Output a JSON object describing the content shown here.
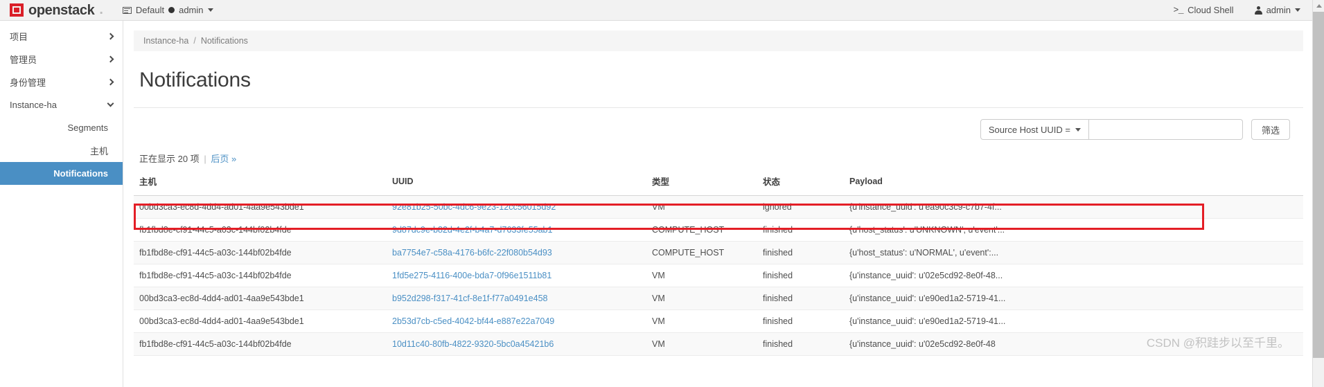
{
  "navbar": {
    "brand": "openstack",
    "brand_dot": ".",
    "domain_label": "Default",
    "project_label": "admin",
    "cloud_shell_icon": ">_",
    "cloud_shell_label": "Cloud Shell",
    "user_label": "admin"
  },
  "sidebar": {
    "groups": [
      {
        "label": "项目",
        "state": "collapsed"
      },
      {
        "label": "管理员",
        "state": "collapsed"
      },
      {
        "label": "身份管理",
        "state": "collapsed"
      },
      {
        "label": "Instance-ha",
        "state": "expanded"
      }
    ],
    "subitems": [
      {
        "label": "Segments",
        "active": false
      },
      {
        "label": "主机",
        "active": false
      },
      {
        "label": "Notifications",
        "active": true
      }
    ]
  },
  "breadcrumb": {
    "parent": "Instance-ha",
    "separator": "/",
    "current": "Notifications"
  },
  "page": {
    "title": "Notifications"
  },
  "toolbar": {
    "filter_field_label": "Source Host UUID =",
    "filter_input_value": "",
    "filter_input_placeholder": "",
    "filter_button_label": "筛选"
  },
  "summary": {
    "count_text": "正在显示 20 项",
    "separator": "|",
    "next_page_label": "后页 »"
  },
  "table": {
    "columns": [
      "主机",
      "UUID",
      "类型",
      "状态",
      "Payload"
    ],
    "rows": [
      {
        "host": "00bd3ca3-ec8d-4dd4-ad01-4aa9e543bde1",
        "uuid": "92e81b25-50bc-4dc6-9e23-12cc56015d92",
        "type": "VM",
        "status": "ignored",
        "payload": "{u'instance_uuid': u'ea90c3c9-c7b7-4f...",
        "highlighted": false
      },
      {
        "host": "fb1fbd8e-cf91-44c5-a03c-144bf02b4fde",
        "uuid": "9d87dc9e-b82d-4e2f-b4a7-d7633fe55ab1",
        "type": "COMPUTE_HOST",
        "status": "finished",
        "payload": "{u'host_status': u'UNKNOWN', u'event'...",
        "highlighted": true
      },
      {
        "host": "fb1fbd8e-cf91-44c5-a03c-144bf02b4fde",
        "uuid": "ba7754e7-c58a-4176-b6fc-22f080b54d93",
        "type": "COMPUTE_HOST",
        "status": "finished",
        "payload": "{u'host_status': u'NORMAL', u'event':...",
        "highlighted": false
      },
      {
        "host": "fb1fbd8e-cf91-44c5-a03c-144bf02b4fde",
        "uuid": "1fd5e275-4116-400e-bda7-0f96e1511b81",
        "type": "VM",
        "status": "finished",
        "payload": "{u'instance_uuid': u'02e5cd92-8e0f-48...",
        "highlighted": false
      },
      {
        "host": "00bd3ca3-ec8d-4dd4-ad01-4aa9e543bde1",
        "uuid": "b952d298-f317-41cf-8e1f-f77a0491e458",
        "type": "VM",
        "status": "finished",
        "payload": "{u'instance_uuid': u'e90ed1a2-5719-41...",
        "highlighted": false
      },
      {
        "host": "00bd3ca3-ec8d-4dd4-ad01-4aa9e543bde1",
        "uuid": "2b53d7cb-c5ed-4042-bf44-e887e22a7049",
        "type": "VM",
        "status": "finished",
        "payload": "{u'instance_uuid': u'e90ed1a2-5719-41...",
        "highlighted": false
      },
      {
        "host": "fb1fbd8e-cf91-44c5-a03c-144bf02b4fde",
        "uuid": "10d11c40-80fb-4822-9320-5bc0a45421b6",
        "type": "VM",
        "status": "finished",
        "payload": "{u'instance_uuid': u'02e5cd92-8e0f-48",
        "highlighted": false
      }
    ]
  },
  "watermark": "CSDN @积跬步以至千里。",
  "colors": {
    "brand_red": "#da1f28",
    "accent_blue": "#4a8fc4",
    "link_blue": "#4a8fc4",
    "highlight_red": "#e41e26"
  }
}
